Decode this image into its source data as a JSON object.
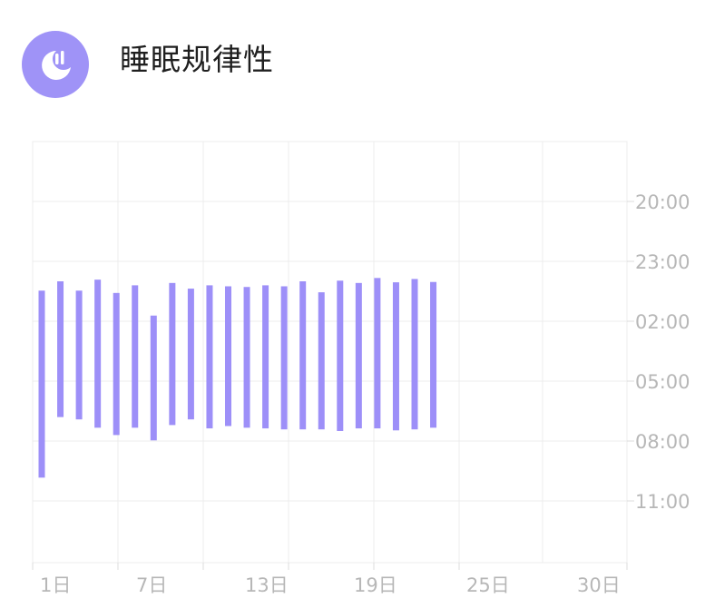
{
  "header": {
    "title": "睡眠规律性",
    "icon_name": "moon-sleep-icon",
    "accent_color": "#9f93f7"
  },
  "chart_data": {
    "type": "bar",
    "title": "",
    "xlabel": "",
    "ylabel": "",
    "color": "#9d8ff8",
    "y_axis_labels": [
      "20:00",
      "23:00",
      "02:00",
      "05:00",
      "08:00",
      "11:00"
    ],
    "x_axis_labels": [
      {
        "day": 1,
        "label": "1日"
      },
      {
        "day": 7,
        "label": "7日"
      },
      {
        "day": 13,
        "label": "13日"
      },
      {
        "day": 19,
        "label": "19日"
      },
      {
        "day": 25,
        "label": "25日"
      },
      {
        "day": 30,
        "label": "30日"
      }
    ],
    "y_min_hours": 17,
    "y_max_hours": 36.5,
    "x_min_day": 1,
    "x_max_day": 31,
    "grid": true,
    "sleep_periods": [
      {
        "day": 1,
        "start": "00:28",
        "end": "09:50"
      },
      {
        "day": 2,
        "start": "00:00",
        "end": "06:48"
      },
      {
        "day": 3,
        "start": "00:28",
        "end": "06:55"
      },
      {
        "day": 4,
        "start": "23:55",
        "end": "07:20"
      },
      {
        "day": 5,
        "start": "00:35",
        "end": "07:42"
      },
      {
        "day": 6,
        "start": "00:12",
        "end": "07:20"
      },
      {
        "day": 7,
        "start": "01:43",
        "end": "07:58"
      },
      {
        "day": 8,
        "start": "00:05",
        "end": "07:12"
      },
      {
        "day": 9,
        "start": "00:22",
        "end": "06:55"
      },
      {
        "day": 10,
        "start": "00:12",
        "end": "07:22"
      },
      {
        "day": 11,
        "start": "00:15",
        "end": "07:15"
      },
      {
        "day": 12,
        "start": "00:17",
        "end": "07:20"
      },
      {
        "day": 13,
        "start": "00:12",
        "end": "07:22"
      },
      {
        "day": 14,
        "start": "00:15",
        "end": "07:25"
      },
      {
        "day": 15,
        "start": "00:00",
        "end": "07:25"
      },
      {
        "day": 16,
        "start": "00:33",
        "end": "07:25"
      },
      {
        "day": 17,
        "start": "23:58",
        "end": "07:30"
      },
      {
        "day": 18,
        "start": "00:05",
        "end": "07:22"
      },
      {
        "day": 19,
        "start": "23:50",
        "end": "07:22"
      },
      {
        "day": 20,
        "start": "00:03",
        "end": "07:28"
      },
      {
        "day": 21,
        "start": "23:53",
        "end": "07:25"
      },
      {
        "day": 22,
        "start": "00:02",
        "end": "07:20"
      }
    ]
  }
}
